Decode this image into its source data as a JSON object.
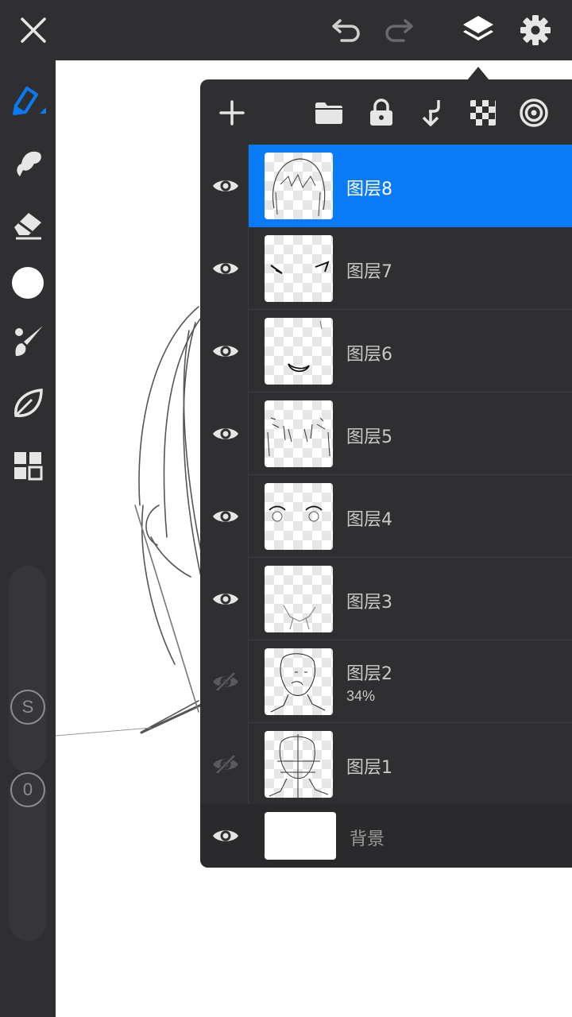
{
  "topbar": {
    "icons": [
      "close-icon",
      "undo-icon",
      "redo-icon",
      "layers-icon",
      "settings-icon"
    ]
  },
  "left_toolbar": {
    "tools": [
      "pen-icon",
      "smudge-icon",
      "eraser-icon",
      "color-swatch",
      "brush-icon",
      "leaf-icon",
      "grid-icon"
    ],
    "current_color": "#ffffff",
    "size_label": "S",
    "opacity_label": "0"
  },
  "layers_panel": {
    "toolbar_icons": [
      "add-icon",
      "folder-icon",
      "lock-icon",
      "merge-down-icon",
      "transparency-icon",
      "spiral-icon"
    ],
    "layers": [
      {
        "name": "图层8",
        "visible": true,
        "selected": true,
        "opacity": ""
      },
      {
        "name": "图层7",
        "visible": true,
        "selected": false,
        "opacity": ""
      },
      {
        "name": "图层6",
        "visible": true,
        "selected": false,
        "opacity": ""
      },
      {
        "name": "图层5",
        "visible": true,
        "selected": false,
        "opacity": ""
      },
      {
        "name": "图层4",
        "visible": true,
        "selected": false,
        "opacity": ""
      },
      {
        "name": "图层3",
        "visible": true,
        "selected": false,
        "opacity": ""
      },
      {
        "name": "图层2",
        "visible": false,
        "selected": false,
        "opacity": "34%"
      },
      {
        "name": "图层1",
        "visible": false,
        "selected": false,
        "opacity": ""
      }
    ],
    "background": {
      "name": "背景",
      "visible": true,
      "color": "#ffffff"
    }
  },
  "colors": {
    "accent": "#0a7bf6",
    "chrome": "#2f2f31",
    "icon": "#e6e6e6"
  }
}
